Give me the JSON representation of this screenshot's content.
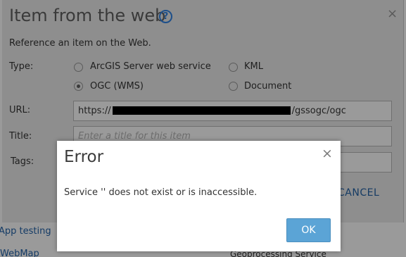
{
  "background": {
    "links": [
      "App testing",
      "WebMap"
    ],
    "right_text": "Geoprocessing Service"
  },
  "dialog": {
    "title": "Item from the web",
    "help_icon": "?",
    "close_icon": "×",
    "subtitle": "Reference an item on the Web.",
    "type_label": "Type:",
    "types": [
      {
        "label": "ArcGIS Server web service",
        "selected": false
      },
      {
        "label": "KML",
        "selected": false
      },
      {
        "label": "OGC (WMS)",
        "selected": true
      },
      {
        "label": "Document",
        "selected": false
      }
    ],
    "url_label": "URL:",
    "url_prefix": "https://",
    "url_suffix": "/gssogc/ogc",
    "title_label": "Title:",
    "title_placeholder": "Enter a title for this item",
    "tags_label": "Tags:",
    "cancel_label": "CANCEL"
  },
  "error": {
    "title": "Error",
    "close_icon": "×",
    "message": "Service '' does not exist or is inaccessible.",
    "ok_label": "OK"
  },
  "colors": {
    "accent": "#5ba4d6",
    "link": "#1d4f8a"
  }
}
